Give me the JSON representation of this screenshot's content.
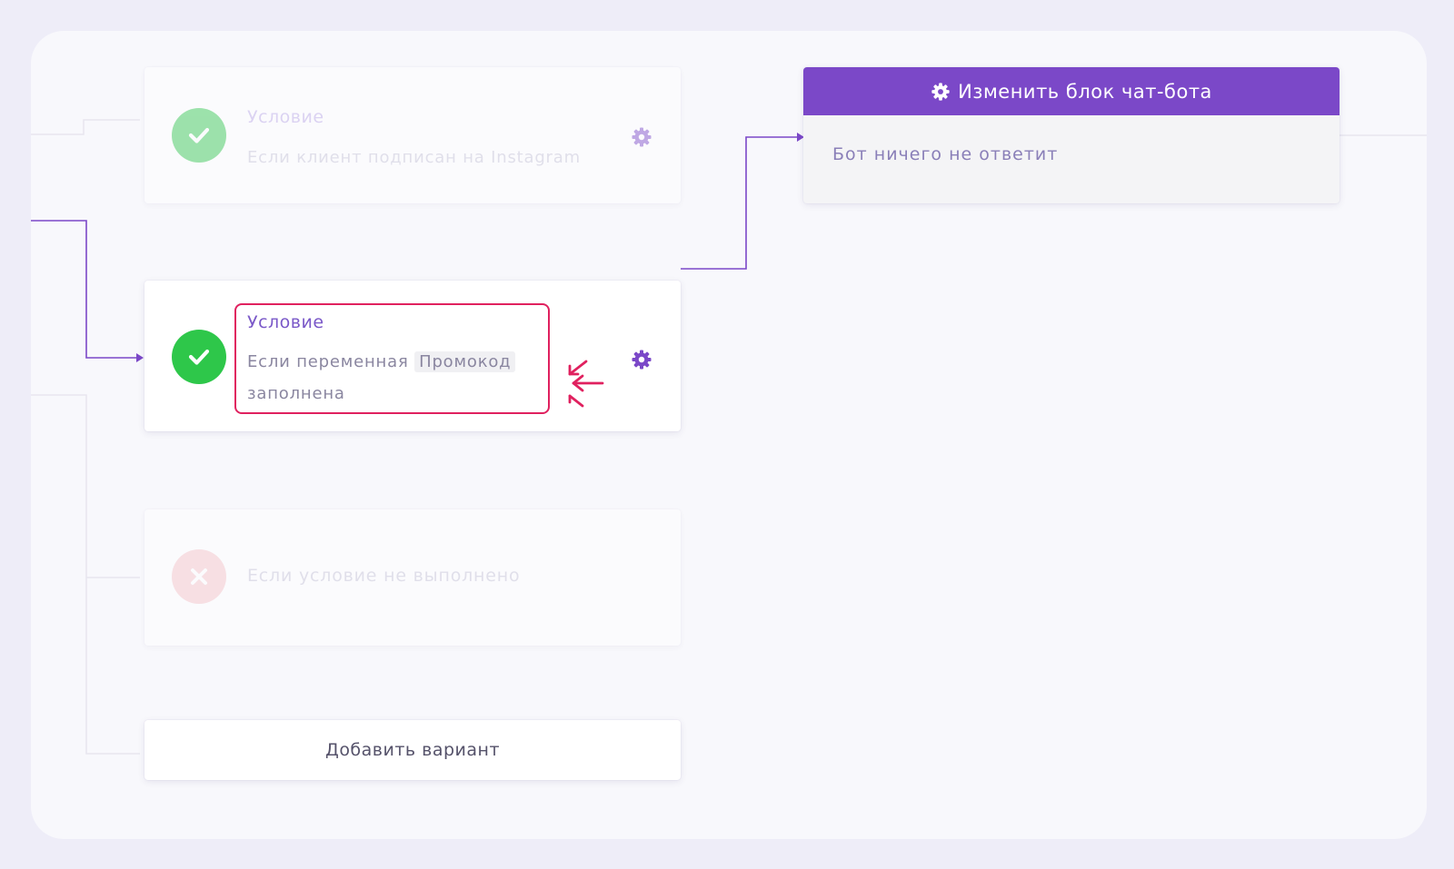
{
  "conditions": [
    {
      "title": "Условие",
      "text": "Если клиент подписан на Instagram",
      "state": "inactive",
      "status_icon": "check-icon"
    },
    {
      "title": "Условие",
      "text_prefix": "Если переменная",
      "variable": "Промокод",
      "text_suffix": "заполнена",
      "state": "active",
      "status_icon": "check-icon"
    },
    {
      "text": "Если условие не выполнено",
      "state": "inactive",
      "status_icon": "cross-icon"
    }
  ],
  "add_variant_label": "Добавить вариант",
  "bot_block": {
    "header": "Изменить блок чат-бота",
    "body": "Бот ничего не ответит",
    "header_icon": "gear-icon"
  },
  "colors": {
    "accent": "#7b48c8",
    "success": "#2ec74a",
    "error": "#f08a92",
    "highlight": "#e0215f"
  }
}
